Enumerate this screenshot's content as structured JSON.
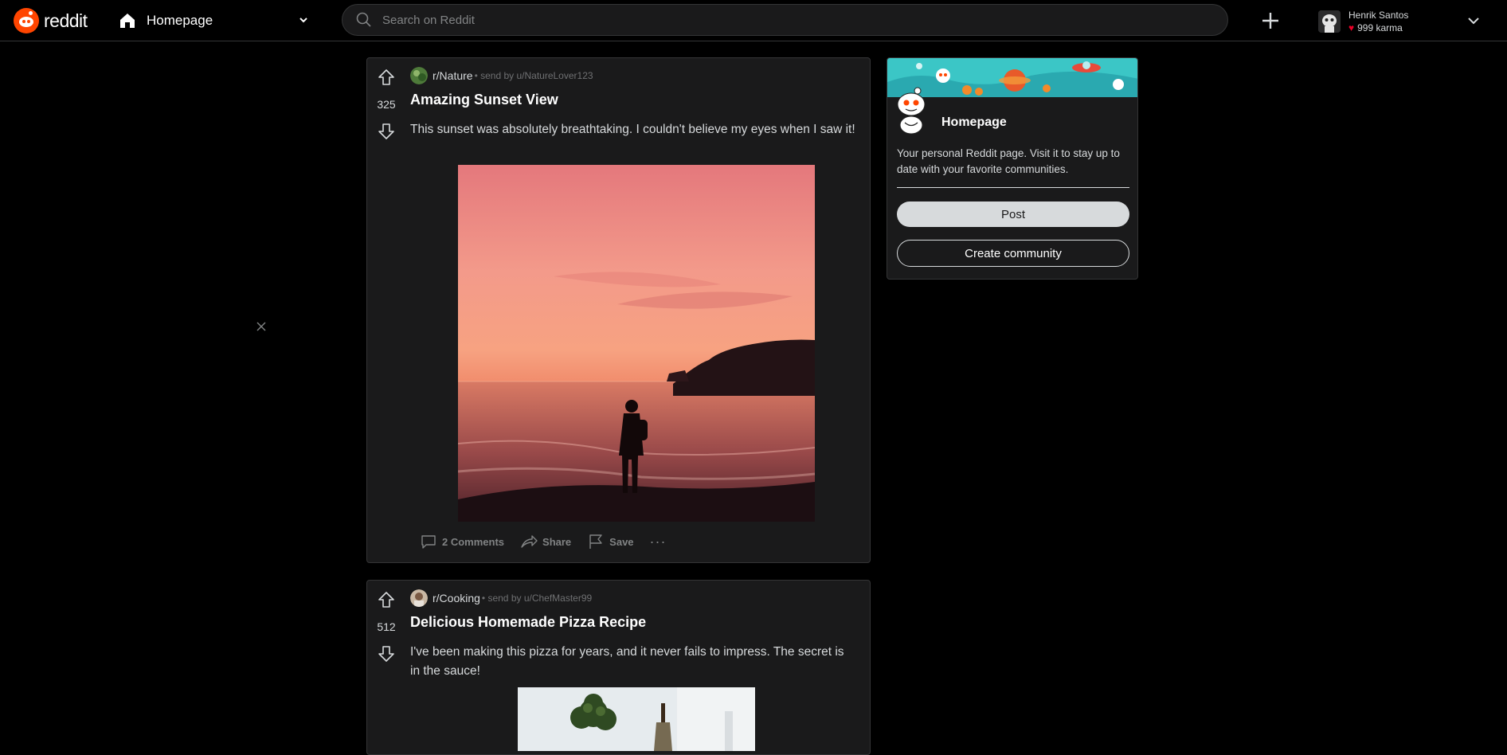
{
  "header": {
    "logo_text": "reddit",
    "feed_label": "Homepage",
    "search_placeholder": "Search on Reddit",
    "user": {
      "name": "Henrik Santos",
      "karma": "999 karma"
    }
  },
  "posts": [
    {
      "subreddit": "r/Nature",
      "sent_by": "• send by u/NatureLover123",
      "score": "325",
      "title": "Amazing Sunset View",
      "body": "This sunset was absolutely breathtaking. I couldn't believe my eyes when I saw it!",
      "actions": {
        "comments": "2 Comments",
        "share": "Share",
        "save": "Save"
      }
    },
    {
      "subreddit": "r/Cooking",
      "sent_by": "• send by u/ChefMaster99",
      "score": "512",
      "title": "Delicious Homemade Pizza Recipe",
      "body": "I've been making this pizza for years, and it never fails to impress. The secret is in the sauce!"
    }
  ],
  "sidebar": {
    "title": "Homepage",
    "description": "Your personal Reddit page. Visit it to stay up to date with your favorite communities.",
    "post_button": "Post",
    "create_button": "Create community"
  },
  "colors": {
    "brand": "#ff4500",
    "background": "#000000",
    "card": "#1a1a1b",
    "border": "#343536",
    "text": "#d7dadc",
    "karma_heart": "#ea0027"
  }
}
